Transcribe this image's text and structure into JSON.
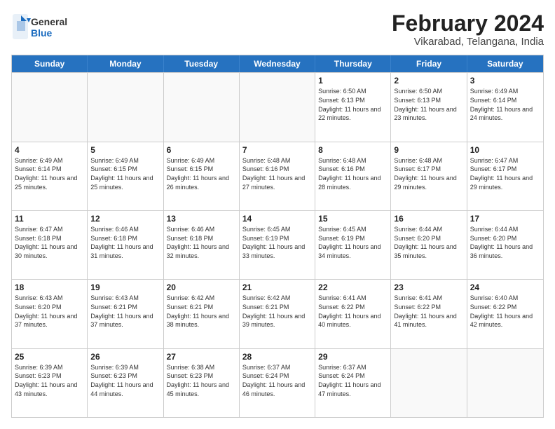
{
  "header": {
    "logo_general": "General",
    "logo_blue": "Blue",
    "title": "February 2024",
    "subtitle": "Vikarabad, Telangana, India"
  },
  "calendar": {
    "days_of_week": [
      "Sunday",
      "Monday",
      "Tuesday",
      "Wednesday",
      "Thursday",
      "Friday",
      "Saturday"
    ],
    "rows": [
      [
        {
          "day": "",
          "info": ""
        },
        {
          "day": "",
          "info": ""
        },
        {
          "day": "",
          "info": ""
        },
        {
          "day": "",
          "info": ""
        },
        {
          "day": "1",
          "info": "Sunrise: 6:50 AM\nSunset: 6:13 PM\nDaylight: 11 hours and 22 minutes."
        },
        {
          "day": "2",
          "info": "Sunrise: 6:50 AM\nSunset: 6:13 PM\nDaylight: 11 hours and 23 minutes."
        },
        {
          "day": "3",
          "info": "Sunrise: 6:49 AM\nSunset: 6:14 PM\nDaylight: 11 hours and 24 minutes."
        }
      ],
      [
        {
          "day": "4",
          "info": "Sunrise: 6:49 AM\nSunset: 6:14 PM\nDaylight: 11 hours and 25 minutes."
        },
        {
          "day": "5",
          "info": "Sunrise: 6:49 AM\nSunset: 6:15 PM\nDaylight: 11 hours and 25 minutes."
        },
        {
          "day": "6",
          "info": "Sunrise: 6:49 AM\nSunset: 6:15 PM\nDaylight: 11 hours and 26 minutes."
        },
        {
          "day": "7",
          "info": "Sunrise: 6:48 AM\nSunset: 6:16 PM\nDaylight: 11 hours and 27 minutes."
        },
        {
          "day": "8",
          "info": "Sunrise: 6:48 AM\nSunset: 6:16 PM\nDaylight: 11 hours and 28 minutes."
        },
        {
          "day": "9",
          "info": "Sunrise: 6:48 AM\nSunset: 6:17 PM\nDaylight: 11 hours and 29 minutes."
        },
        {
          "day": "10",
          "info": "Sunrise: 6:47 AM\nSunset: 6:17 PM\nDaylight: 11 hours and 29 minutes."
        }
      ],
      [
        {
          "day": "11",
          "info": "Sunrise: 6:47 AM\nSunset: 6:18 PM\nDaylight: 11 hours and 30 minutes."
        },
        {
          "day": "12",
          "info": "Sunrise: 6:46 AM\nSunset: 6:18 PM\nDaylight: 11 hours and 31 minutes."
        },
        {
          "day": "13",
          "info": "Sunrise: 6:46 AM\nSunset: 6:18 PM\nDaylight: 11 hours and 32 minutes."
        },
        {
          "day": "14",
          "info": "Sunrise: 6:45 AM\nSunset: 6:19 PM\nDaylight: 11 hours and 33 minutes."
        },
        {
          "day": "15",
          "info": "Sunrise: 6:45 AM\nSunset: 6:19 PM\nDaylight: 11 hours and 34 minutes."
        },
        {
          "day": "16",
          "info": "Sunrise: 6:44 AM\nSunset: 6:20 PM\nDaylight: 11 hours and 35 minutes."
        },
        {
          "day": "17",
          "info": "Sunrise: 6:44 AM\nSunset: 6:20 PM\nDaylight: 11 hours and 36 minutes."
        }
      ],
      [
        {
          "day": "18",
          "info": "Sunrise: 6:43 AM\nSunset: 6:20 PM\nDaylight: 11 hours and 37 minutes."
        },
        {
          "day": "19",
          "info": "Sunrise: 6:43 AM\nSunset: 6:21 PM\nDaylight: 11 hours and 37 minutes."
        },
        {
          "day": "20",
          "info": "Sunrise: 6:42 AM\nSunset: 6:21 PM\nDaylight: 11 hours and 38 minutes."
        },
        {
          "day": "21",
          "info": "Sunrise: 6:42 AM\nSunset: 6:21 PM\nDaylight: 11 hours and 39 minutes."
        },
        {
          "day": "22",
          "info": "Sunrise: 6:41 AM\nSunset: 6:22 PM\nDaylight: 11 hours and 40 minutes."
        },
        {
          "day": "23",
          "info": "Sunrise: 6:41 AM\nSunset: 6:22 PM\nDaylight: 11 hours and 41 minutes."
        },
        {
          "day": "24",
          "info": "Sunrise: 6:40 AM\nSunset: 6:22 PM\nDaylight: 11 hours and 42 minutes."
        }
      ],
      [
        {
          "day": "25",
          "info": "Sunrise: 6:39 AM\nSunset: 6:23 PM\nDaylight: 11 hours and 43 minutes."
        },
        {
          "day": "26",
          "info": "Sunrise: 6:39 AM\nSunset: 6:23 PM\nDaylight: 11 hours and 44 minutes."
        },
        {
          "day": "27",
          "info": "Sunrise: 6:38 AM\nSunset: 6:23 PM\nDaylight: 11 hours and 45 minutes."
        },
        {
          "day": "28",
          "info": "Sunrise: 6:37 AM\nSunset: 6:24 PM\nDaylight: 11 hours and 46 minutes."
        },
        {
          "day": "29",
          "info": "Sunrise: 6:37 AM\nSunset: 6:24 PM\nDaylight: 11 hours and 47 minutes."
        },
        {
          "day": "",
          "info": ""
        },
        {
          "day": "",
          "info": ""
        }
      ]
    ]
  }
}
